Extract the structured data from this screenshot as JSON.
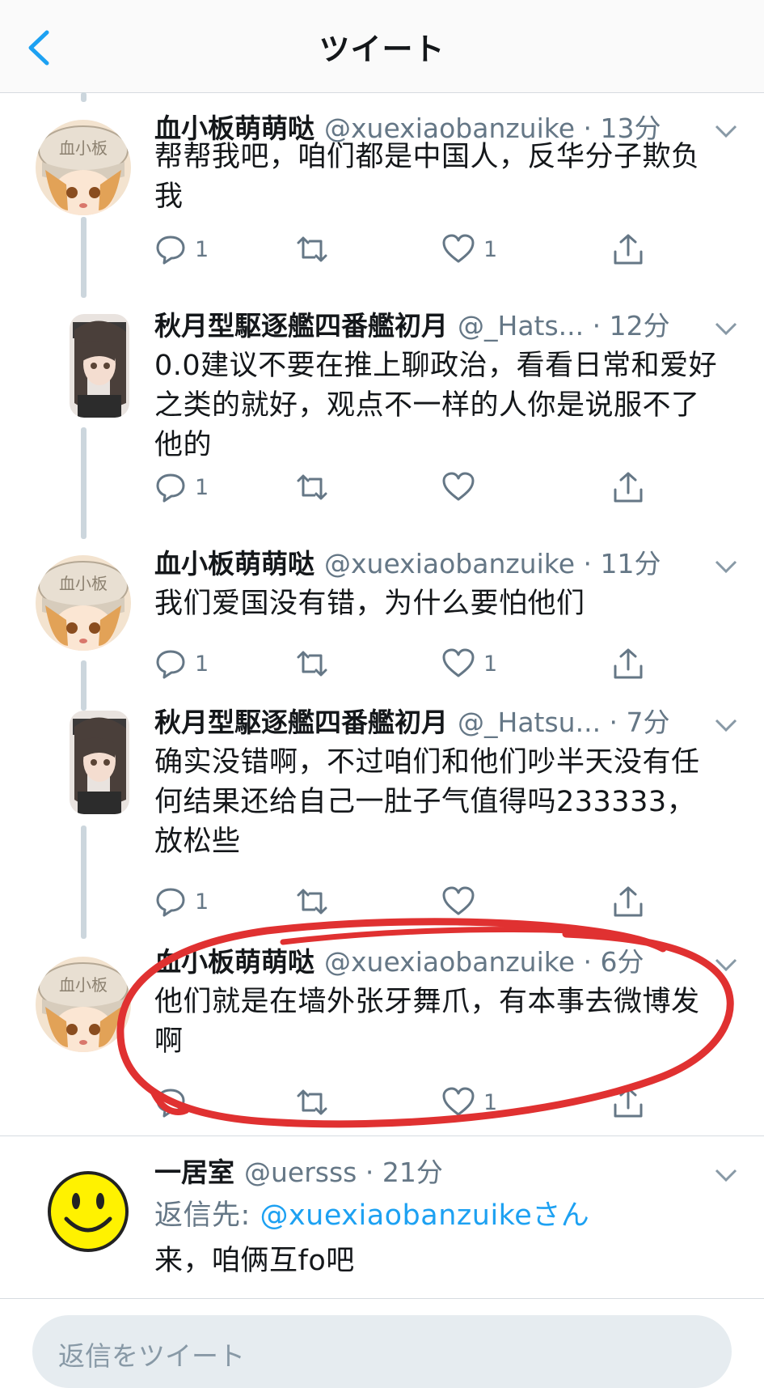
{
  "header": {
    "title": "ツイート"
  },
  "tweets": [
    {
      "name": "血小板萌萌哒",
      "handle": "@xuexiaobanzuike",
      "time": "13分",
      "text": "帮帮我吧，咱们都是中国人，反华分子欺负我",
      "replies": "1",
      "retweets": "",
      "likes": "1",
      "avatar": "hat-girl"
    },
    {
      "name": "秋月型駆逐艦四番艦初月",
      "handle": "@_Hats...",
      "time": "12分",
      "text": "0.0建议不要在推上聊政治，看看日常和爱好之类的就好，观点不一样的人你是说服不了他的",
      "replies": "1",
      "retweets": "",
      "likes": "",
      "avatar": "dark-hair-girl"
    },
    {
      "name": "血小板萌萌哒",
      "handle": "@xuexiaobanzuike",
      "time": "11分",
      "text": "我们爱国没有错，为什么要怕他们",
      "replies": "1",
      "retweets": "",
      "likes": "1",
      "avatar": "hat-girl"
    },
    {
      "name": "秋月型駆逐艦四番艦初月",
      "handle": "@_Hatsu...",
      "time": "7分",
      "text": "确实没错啊，不过咱们和他们吵半天没有任何结果还给自己一肚子气值得吗233333，放松些",
      "replies": "1",
      "retweets": "",
      "likes": "",
      "avatar": "dark-hair-girl"
    },
    {
      "name": "血小板萌萌哒",
      "handle": "@xuexiaobanzuike",
      "time": "6分",
      "text": "他们就是在墙外张牙舞爪，有本事去微博发啊",
      "replies": "",
      "retweets": "",
      "likes": "1",
      "avatar": "hat-girl"
    }
  ],
  "reply_tweet": {
    "name": "一居室",
    "handle": "@uersss",
    "time": "21分",
    "reply_prefix": "返信先:",
    "reply_target": "@xuexiaobanzuikeさん",
    "text": "来，咱俩互fo吧",
    "avatar": "smiley-face"
  },
  "compose": {
    "placeholder": "返信をツイート"
  },
  "colors": {
    "accent": "#1da1f2",
    "muted": "#657786",
    "annotation": "#e03131"
  }
}
